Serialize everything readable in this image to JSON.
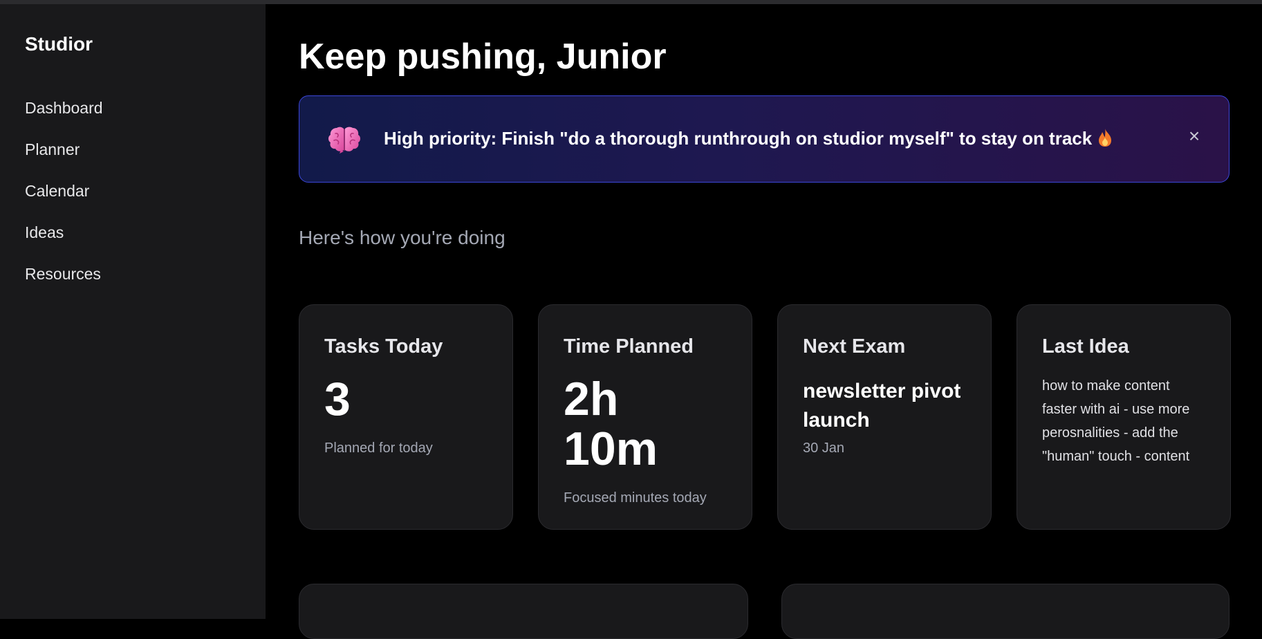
{
  "app": {
    "brand": "Studior"
  },
  "sidebar": {
    "items": [
      {
        "label": "Dashboard"
      },
      {
        "label": "Planner"
      },
      {
        "label": "Calendar"
      },
      {
        "label": "Ideas"
      },
      {
        "label": "Resources"
      }
    ]
  },
  "header": {
    "title": "Keep pushing, Junior"
  },
  "alert": {
    "icon": "brain-icon",
    "text": "High priority: Finish \"do a thorough runthrough on studior myself\" to stay on track",
    "trailing_icon": "fire-icon",
    "close_icon": "close-icon",
    "close_symbol": "×"
  },
  "section": {
    "subtitle": "Here's how you're doing"
  },
  "cards": [
    {
      "title": "Tasks Today",
      "value": "3",
      "caption": "Planned for today"
    },
    {
      "title": "Time Planned",
      "value": "2h 10m",
      "caption": "Focused minutes today"
    },
    {
      "title": "Next Exam",
      "value": "newsletter pivot launch",
      "caption": "30 Jan"
    },
    {
      "title": "Last Idea",
      "body": "how to make content faster with ai - use more perosnalities - add the \"human\" touch - content"
    }
  ],
  "colors": {
    "background": "#000000",
    "sidebar": "#19191b",
    "card": "#19191b",
    "alert_border": "#3b46d8",
    "muted_text": "#a4a8b4"
  }
}
